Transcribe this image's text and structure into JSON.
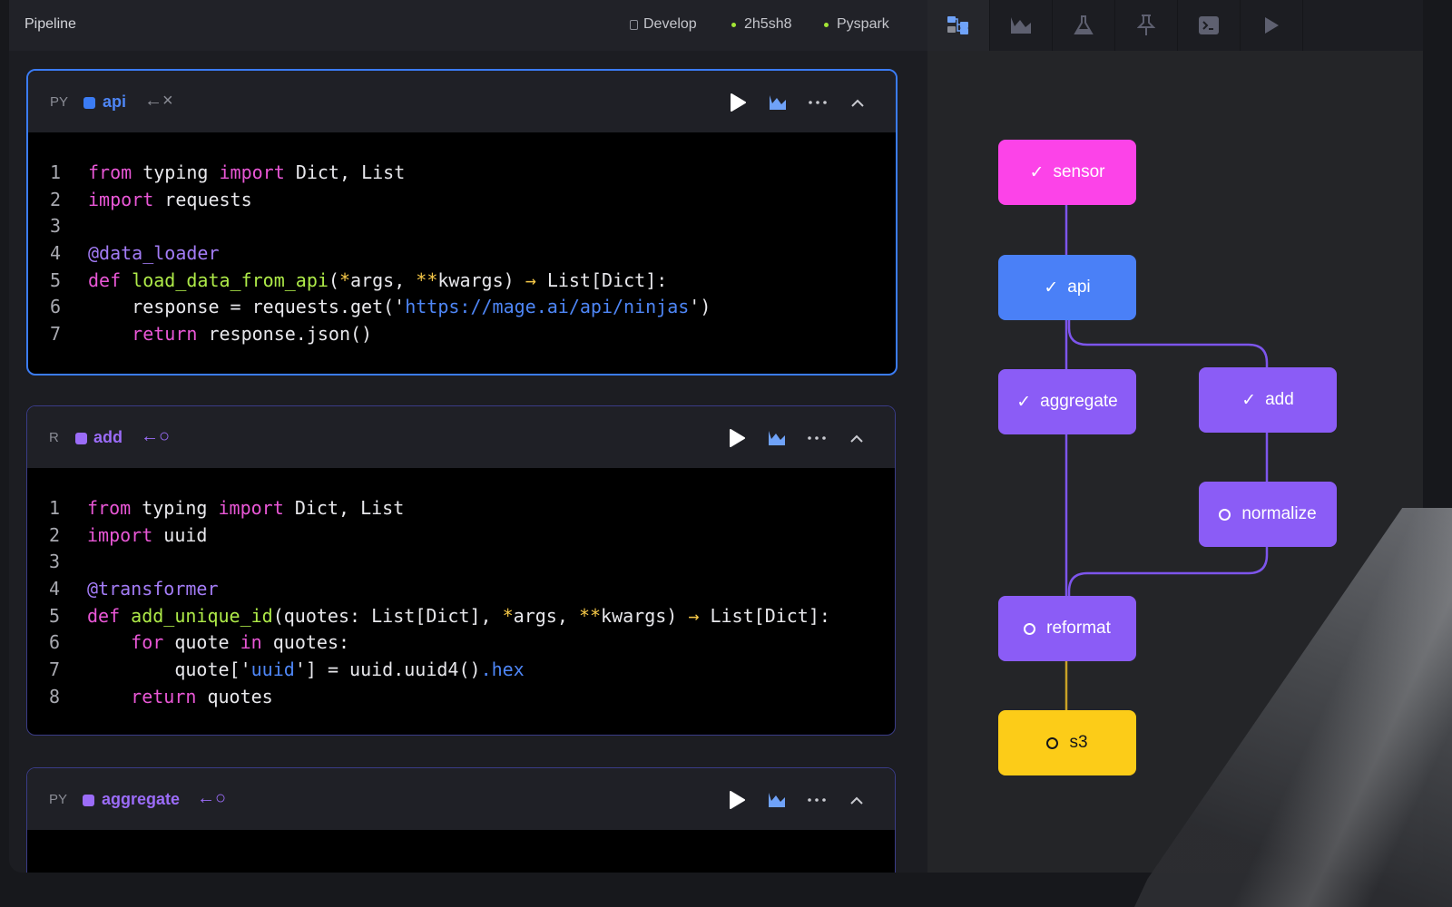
{
  "topbar": {
    "title": "Pipeline",
    "mode": "Develop",
    "kernel_id": "2h5sh8",
    "kernel": "Pyspark"
  },
  "right_tabs": [
    {
      "icon": "dependency-tree-icon",
      "active": true
    },
    {
      "icon": "chart-icon",
      "active": false
    },
    {
      "icon": "flask-icon",
      "active": false
    },
    {
      "icon": "pin-icon",
      "active": false
    },
    {
      "icon": "terminal-icon",
      "active": false
    },
    {
      "icon": "play-triangle-icon",
      "active": false
    }
  ],
  "blocks": [
    {
      "lang": "PY",
      "name": "api",
      "arrow": "←×",
      "color": "#3b7cf4",
      "lines": [
        [
          "1",
          "from typing import Dict, List"
        ],
        [
          "2",
          "import requests"
        ],
        [
          "3",
          ""
        ],
        [
          "4",
          "@data_loader"
        ],
        [
          "5",
          "def load_data_from_api(*args, **kwargs) → List[Dict]:"
        ],
        [
          "6",
          "    response = requests.get('https://mage.ai/api/ninjas')"
        ],
        [
          "7",
          "    return response.json()"
        ]
      ]
    },
    {
      "lang": "R",
      "name": "add",
      "arrow": "←○",
      "color": "#9b6cf8",
      "lines": [
        [
          "1",
          "from typing import Dict, List"
        ],
        [
          "2",
          "import uuid"
        ],
        [
          "3",
          ""
        ],
        [
          "4",
          "@transformer"
        ],
        [
          "5",
          "def add_unique_id(quotes: List[Dict], *args, **kwargs) → List[Dict]:"
        ],
        [
          "6",
          "    for quote in quotes:"
        ],
        [
          "7",
          "        quote['uuid'] = uuid.uuid4().hex"
        ],
        [
          "8",
          "    return quotes"
        ]
      ]
    },
    {
      "lang": "PY",
      "name": "aggregate",
      "arrow": "←○",
      "color": "#9b6cf8",
      "lines": []
    }
  ],
  "graph": {
    "nodes": [
      {
        "label": "sensor",
        "status": "done",
        "color": "#fc43e8"
      },
      {
        "label": "api",
        "status": "done",
        "color": "#4a80f7"
      },
      {
        "label": "aggregate",
        "status": "done",
        "color": "#8b5cf6"
      },
      {
        "label": "add",
        "status": "done",
        "color": "#8b5cf6"
      },
      {
        "label": "normalize",
        "status": "pending",
        "color": "#8b5cf6"
      },
      {
        "label": "reformat",
        "status": "pending",
        "color": "#8b5cf6"
      },
      {
        "label": "s3",
        "status": "pending",
        "color": "#fccc18"
      }
    ],
    "edge_color": "#7d55ec"
  }
}
